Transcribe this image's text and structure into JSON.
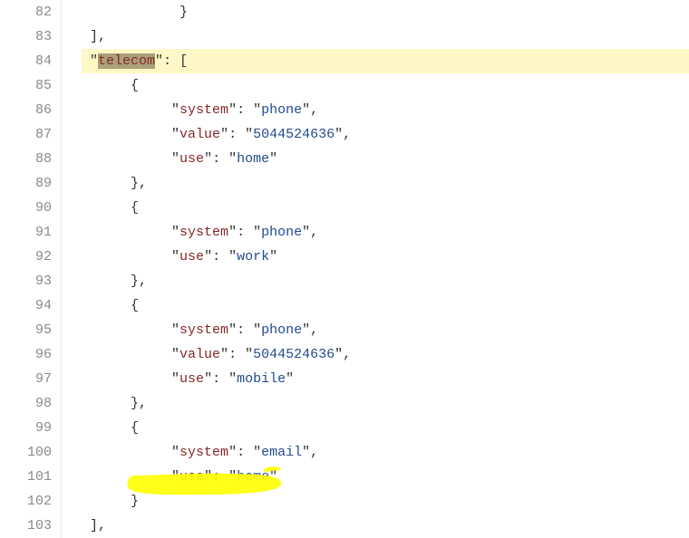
{
  "lines": {
    "82": "82",
    "83": "83",
    "84": "84",
    "85": "85",
    "86": "86",
    "87": "87",
    "88": "88",
    "89": "89",
    "90": "90",
    "91": "91",
    "92": "92",
    "93": "93",
    "94": "94",
    "95": "95",
    "96": "96",
    "97": "97",
    "98": "98",
    "99": "99",
    "100": "100",
    "101": "101",
    "102": "102",
    "103": "103"
  },
  "tok": {
    "closeBrace": "}",
    "closeBracketComma": "],",
    "openBracket": "[",
    "openBrace": "{",
    "closeBraceComma": "},",
    "q": "\"",
    "colon": ": ",
    "comma": ",",
    "telecom": "telecom",
    "system": "system",
    "value": "value",
    "use": "use",
    "phone": "phone",
    "work": "work",
    "home": "home",
    "mobile": "mobile",
    "email": "email",
    "v5044524636": "5044524636"
  },
  "code_data": {
    "property": "telecom",
    "value": [
      {
        "system": "phone",
        "value": "5044524636",
        "use": "home"
      },
      {
        "system": "phone",
        "use": "work"
      },
      {
        "system": "phone",
        "value": "5044524636",
        "use": "mobile"
      },
      {
        "system": "email",
        "use": "home"
      }
    ],
    "selection": {
      "line": 84,
      "text": "telecom"
    },
    "highlight_line": 84,
    "annotation": {
      "lines": [
        101
      ],
      "style": "yellow-marker"
    }
  }
}
